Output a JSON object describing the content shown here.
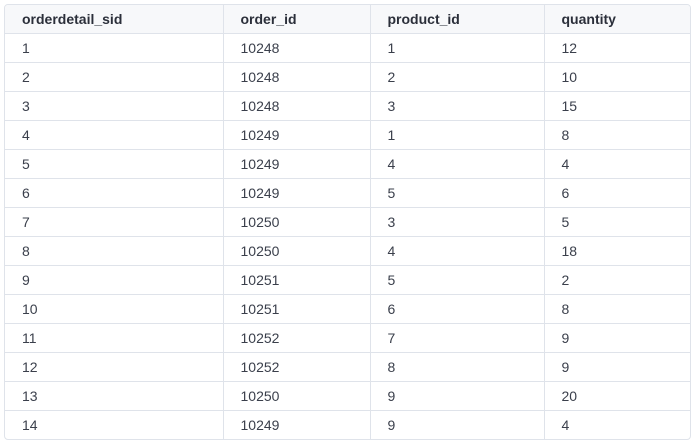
{
  "table": {
    "columns": [
      "orderdetail_sid",
      "order_id",
      "product_id",
      "quantity"
    ],
    "rows": [
      [
        "1",
        "10248",
        "1",
        "12"
      ],
      [
        "2",
        "10248",
        "2",
        "10"
      ],
      [
        "3",
        "10248",
        "3",
        "15"
      ],
      [
        "4",
        "10249",
        "1",
        "8"
      ],
      [
        "5",
        "10249",
        "4",
        "4"
      ],
      [
        "6",
        "10249",
        "5",
        "6"
      ],
      [
        "7",
        "10250",
        "3",
        "5"
      ],
      [
        "8",
        "10250",
        "4",
        "18"
      ],
      [
        "9",
        "10251",
        "5",
        "2"
      ],
      [
        "10",
        "10251",
        "6",
        "8"
      ],
      [
        "11",
        "10252",
        "7",
        "9"
      ],
      [
        "12",
        "10252",
        "8",
        "9"
      ],
      [
        "13",
        "10250",
        "9",
        "20"
      ],
      [
        "14",
        "10249",
        "9",
        "4"
      ]
    ]
  }
}
